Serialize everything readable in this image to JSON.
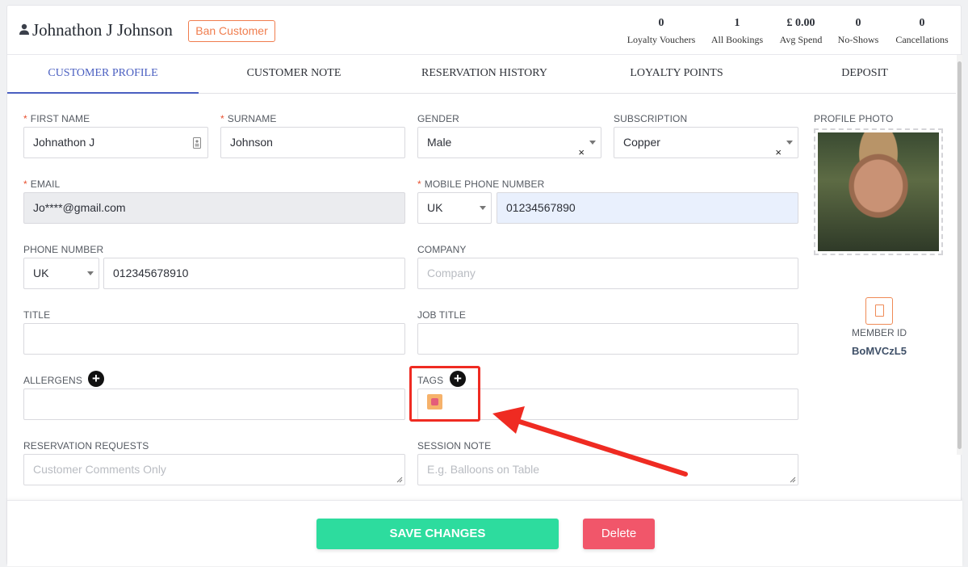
{
  "header": {
    "name": "Johnathon J Johnson",
    "ban_label": "Ban Customer",
    "stats": [
      {
        "value": "0",
        "label": "Loyalty Vouchers"
      },
      {
        "value": "1",
        "label": "All Bookings"
      },
      {
        "value": "£ 0.00",
        "label": "Avg Spend"
      },
      {
        "value": "0",
        "label": "No-Shows"
      },
      {
        "value": "0",
        "label": "Cancellations"
      }
    ]
  },
  "tabs": [
    "CUSTOMER PROFILE",
    "CUSTOMER NOTE",
    "RESERVATION HISTORY",
    "LOYALTY POINTS",
    "DEPOSIT"
  ],
  "form": {
    "first_name": {
      "label": "FIRST NAME",
      "value": "Johnathon J"
    },
    "surname": {
      "label": "SURNAME",
      "value": "Johnson"
    },
    "gender": {
      "label": "GENDER",
      "value": "Male"
    },
    "subscription": {
      "label": "SUBSCRIPTION",
      "value": "Copper"
    },
    "email": {
      "label": "EMAIL",
      "value": "Jo****@gmail.com"
    },
    "mobile": {
      "label": "MOBILE PHONE NUMBER",
      "country": "UK",
      "value": "01234567890"
    },
    "phone": {
      "label": "PHONE NUMBER",
      "country": "UK",
      "value": "012345678910"
    },
    "company": {
      "label": "COMPANY",
      "placeholder": "Company"
    },
    "title": {
      "label": "TITLE"
    },
    "job_title": {
      "label": "JOB TITLE"
    },
    "allergens": {
      "label": "ALLERGENS"
    },
    "tags": {
      "label": "TAGS"
    },
    "reservation_requests": {
      "label": "RESERVATION REQUESTS",
      "placeholder": "Customer Comments Only"
    },
    "session_note": {
      "label": "SESSION NOTE",
      "placeholder": "E.g. Balloons on Table"
    },
    "clear_symbol": "×",
    "add_symbol": "+"
  },
  "profile": {
    "photo_label": "PROFILE PHOTO",
    "member_label": "MEMBER ID",
    "member_id": "BoMVCzL5"
  },
  "footer": {
    "save_label": "SAVE CHANGES",
    "delete_label": "Delete"
  },
  "colors": {
    "accent": "#4a5fc1",
    "save": "#2ddc9e",
    "delete": "#f1566a",
    "ban": "#f07d4e",
    "annotation": "#ef2b22"
  }
}
